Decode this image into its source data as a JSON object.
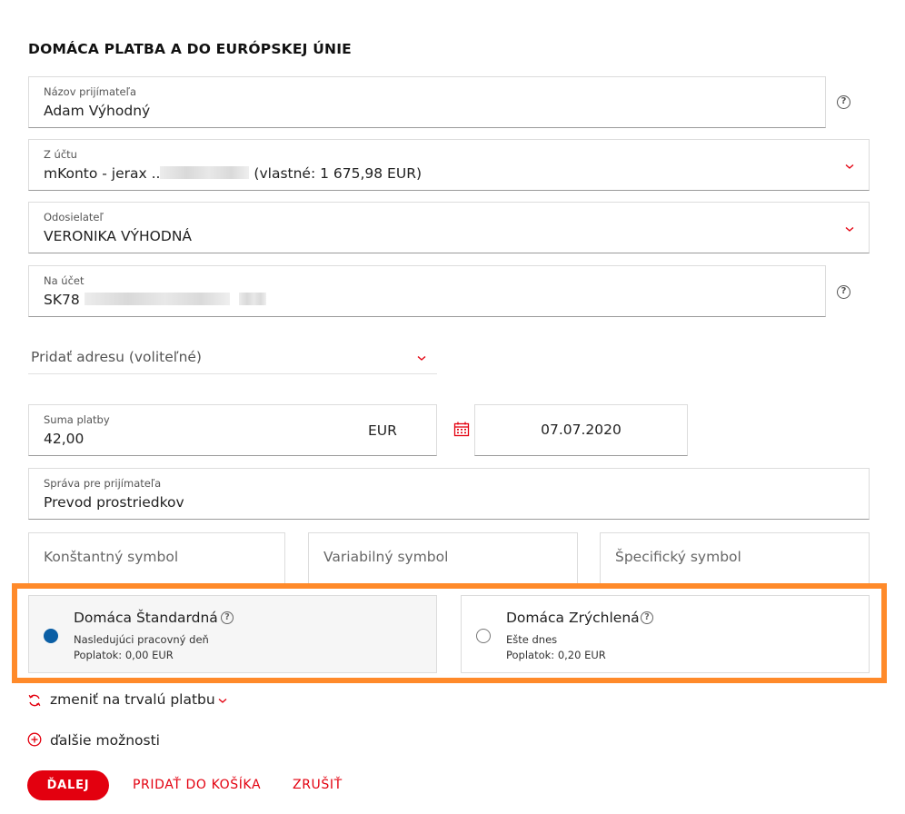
{
  "title": "DOMÁCA PLATBA A DO EURÓPSKEJ ÚNIE",
  "recipient": {
    "label": "Názov prijímateľa",
    "value": "Adam Výhodný"
  },
  "from_account": {
    "label": "Z účtu",
    "value_prefix": "mKonto - jerax ..",
    "value_suffix": "(vlastné: 1 675,98 EUR)"
  },
  "sender": {
    "label": "Odosielateľ",
    "value": "VERONIKA VÝHODNÁ"
  },
  "to_account": {
    "label": "Na účet",
    "value_prefix": "SK78"
  },
  "address": {
    "placeholder": "Pridať adresu (voliteľné)"
  },
  "amount": {
    "label": "Suma platby",
    "value": "42,00",
    "currency": "EUR"
  },
  "date": {
    "value": "07.07.2020"
  },
  "message": {
    "label": "Správa pre prijímateľa",
    "value": "Prevod prostriedkov"
  },
  "symbols": {
    "constant": "Konštantný symbol",
    "variable": "Variabilný symbol",
    "specific": "Špecifický symbol"
  },
  "payment_options": [
    {
      "name": "Domáca Štandardná",
      "desc": "Nasledujúci pracovný deň",
      "fee": "Poplatok: 0,00 EUR",
      "selected": true
    },
    {
      "name": "Domáca Zrýchlená",
      "desc": "Ešte dnes",
      "fee": "Poplatok: 0,20 EUR",
      "selected": false
    }
  ],
  "links": {
    "recurring": "zmeniť na trvalú platbu",
    "more": "ďalšie možnosti"
  },
  "buttons": {
    "next": "ĎALEJ",
    "add_to_cart": "PRIDAŤ DO KOŠÍKA",
    "cancel": "ZRUŠIŤ"
  },
  "colors": {
    "accent": "#e3000f",
    "radio_selected": "#0b5fa5",
    "highlight": "#ff8a2a"
  },
  "icons": {
    "help": "help-icon",
    "chevron": "chevron-down-icon",
    "calendar": "calendar-icon",
    "recurring": "refresh-icon",
    "more": "plus-circle-icon"
  }
}
